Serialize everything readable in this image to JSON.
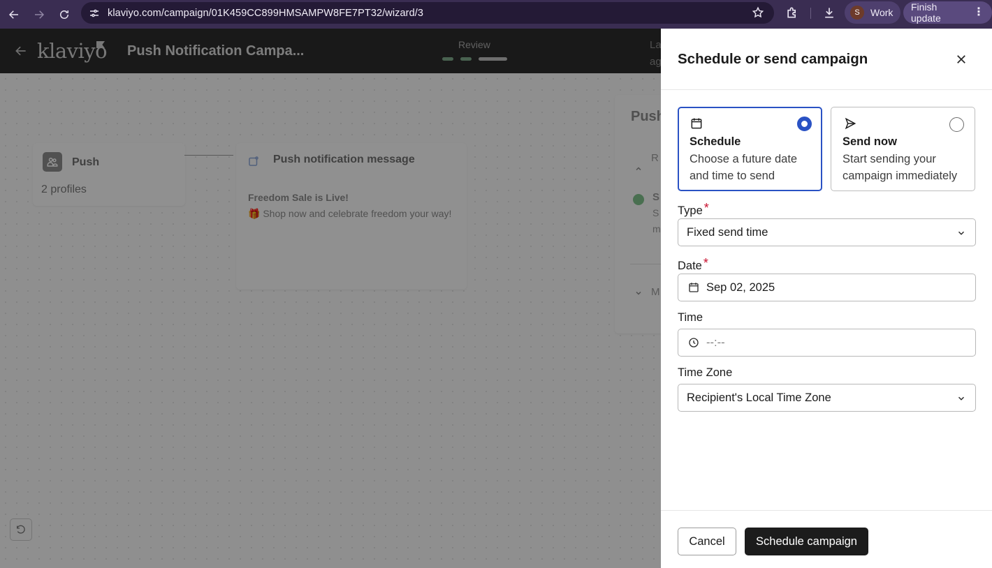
{
  "browser": {
    "url": "klaviyo.com/campaign/01K459CC899HMSAMPW8FE7PT32/wizard/3",
    "profile_initial": "S",
    "profile_label": "Work",
    "update_label": "Finish update",
    "icons": [
      "back-icon",
      "forward-icon",
      "reload-icon",
      "site-settings-icon",
      "star-icon",
      "extensions-icon",
      "download-icon",
      "more-icon"
    ]
  },
  "app": {
    "logo": "klaviyo",
    "campaign_title": "Push Notification Campa...",
    "step_label": "Review",
    "header_right_partial": "La\nag",
    "push_card": {
      "title": "Push",
      "profiles": "2 profiles"
    },
    "message_card": {
      "title": "Push notification message",
      "message_title": "Freedom Sale is Live!",
      "message_body": "🎁 Shop now and celebrate freedom your way!"
    },
    "side_card": {
      "title": "Push",
      "section1": "R",
      "item": "S",
      "item_sub1": "S",
      "item_sub2": "m",
      "section2": "M"
    },
    "colors": {
      "step_done": "#7ea98a",
      "step_current": "#bdbdbd"
    }
  },
  "drawer": {
    "title": "Schedule or send campaign",
    "options": [
      {
        "label": "Schedule",
        "description": "Choose a future date and time to send",
        "selected": true,
        "icon": "calendar-icon"
      },
      {
        "label": "Send now",
        "description": "Start sending your campaign immediately",
        "selected": false,
        "icon": "send-icon"
      }
    ],
    "type": {
      "label": "Type",
      "required": "*",
      "value": "Fixed send time"
    },
    "date": {
      "label": "Date",
      "required": "*",
      "value": "Sep 02, 2025"
    },
    "time": {
      "label": "Time",
      "placeholder": "--:--"
    },
    "timezone": {
      "label": "Time Zone",
      "value": "Recipient's Local Time Zone"
    },
    "cancel_label": "Cancel",
    "submit_label": "Schedule campaign",
    "colors": {
      "accent": "#2a52c4",
      "primary_button": "#1c1c1c",
      "required": "#c8102e"
    }
  }
}
